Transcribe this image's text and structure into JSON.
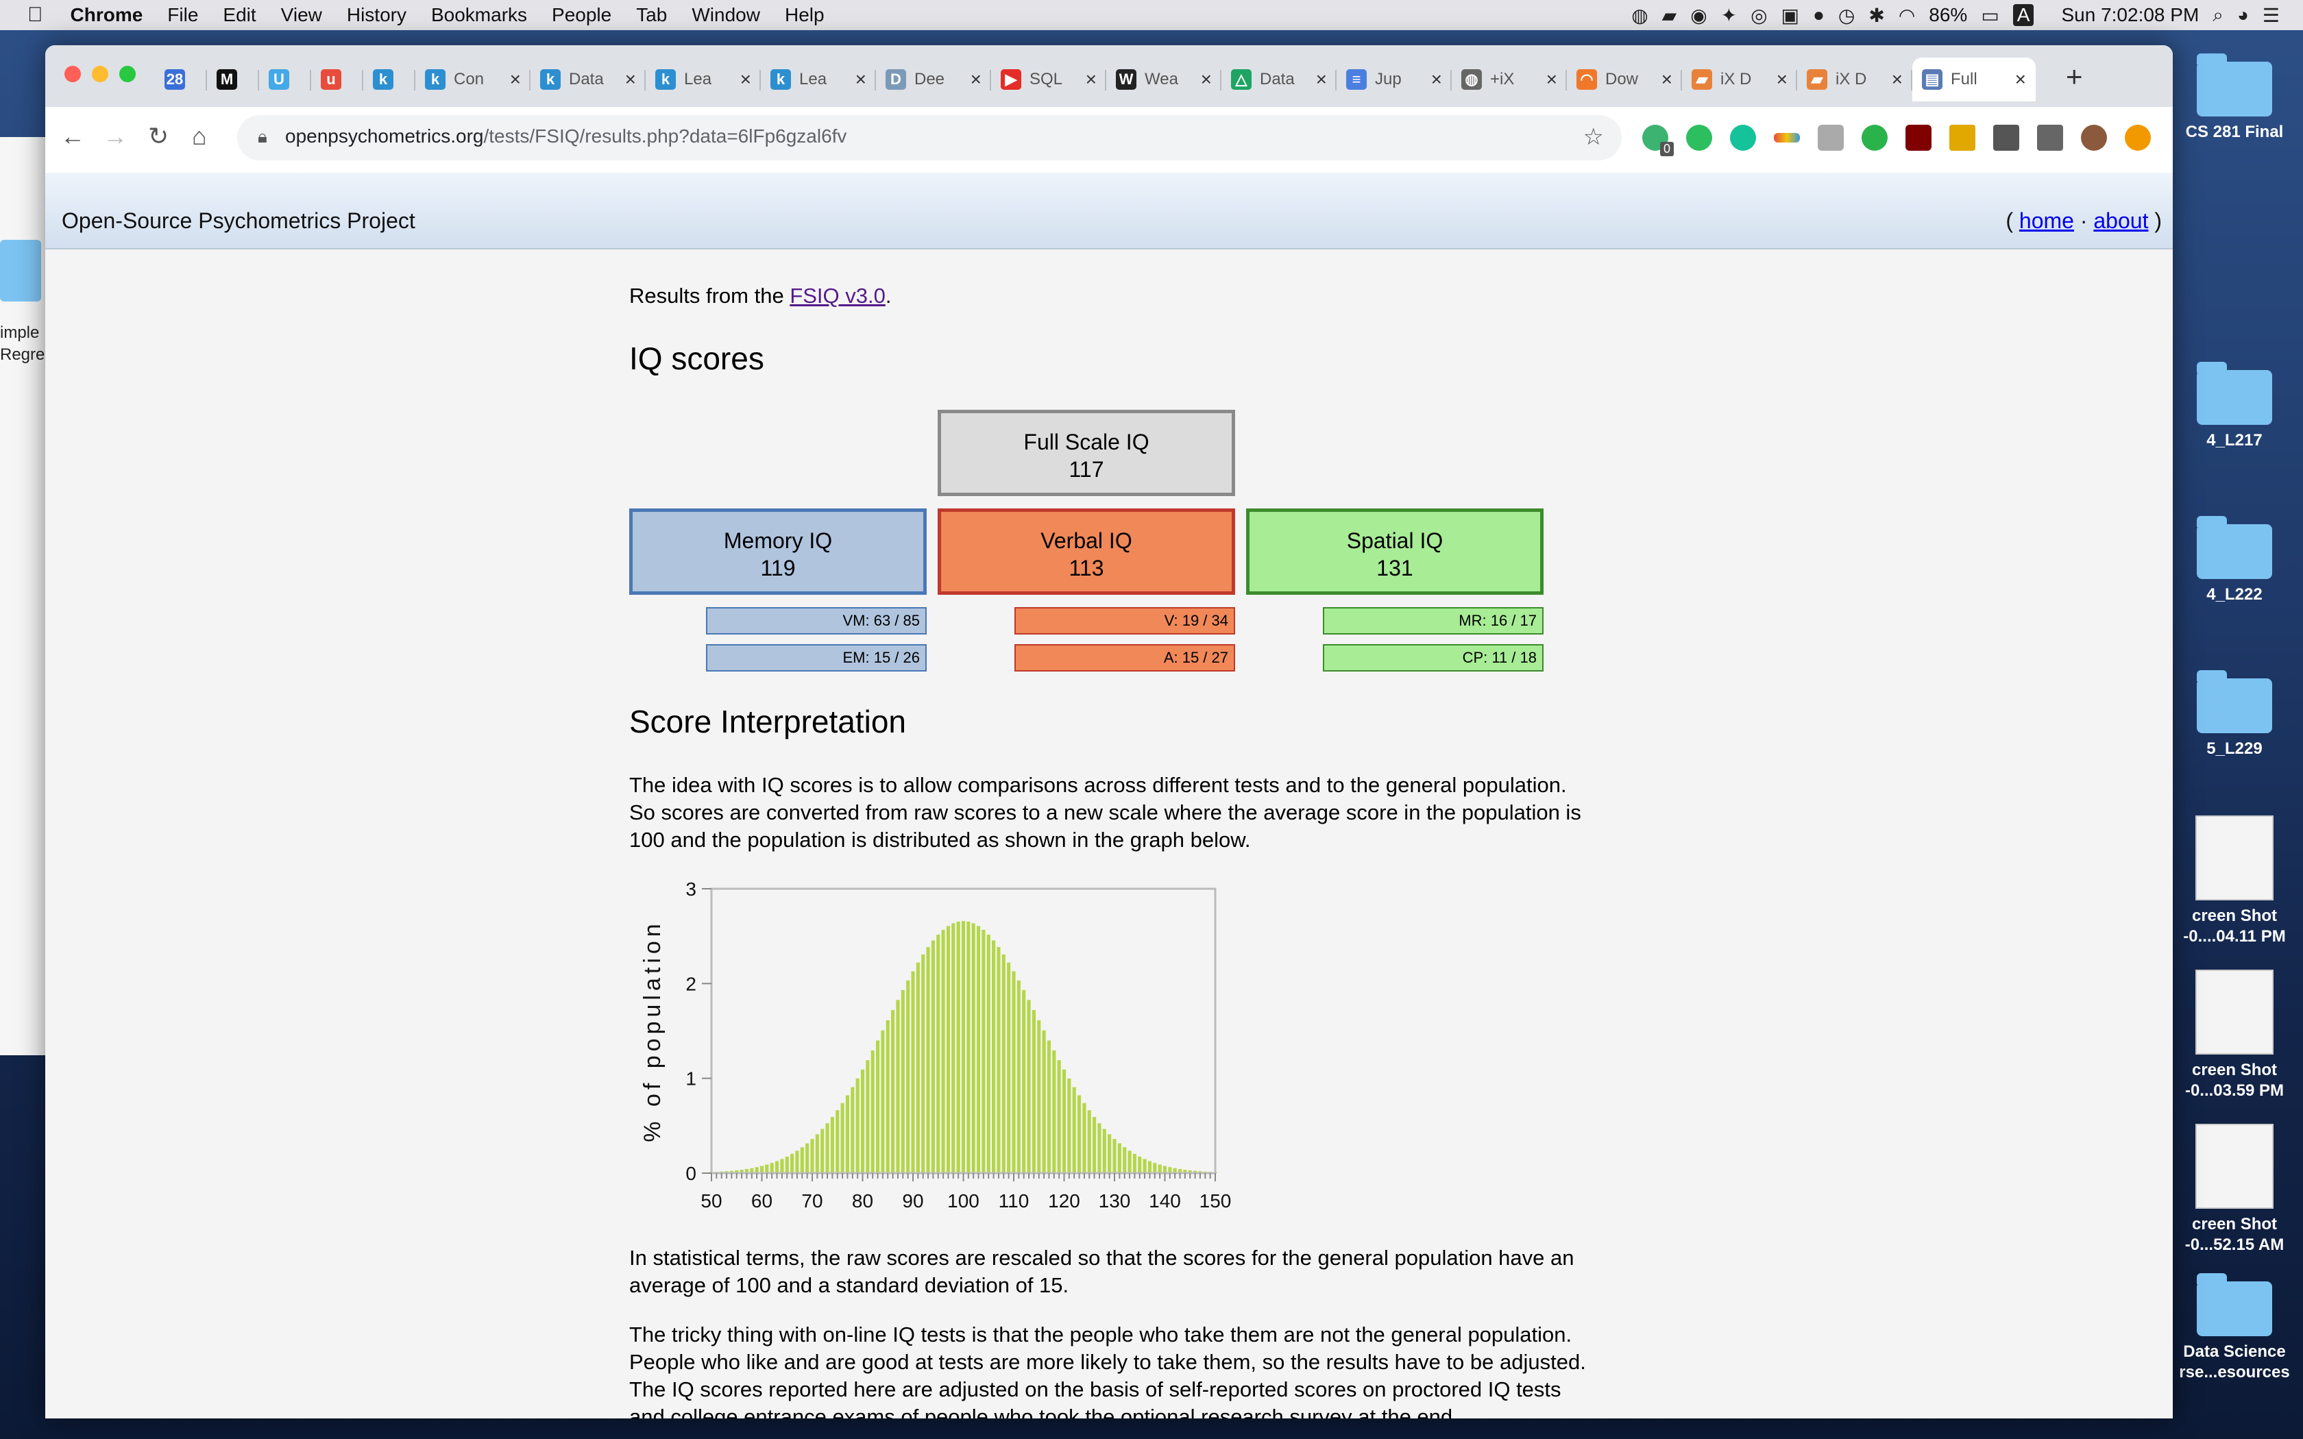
{
  "menubar": {
    "app": "Chrome",
    "items": [
      "File",
      "Edit",
      "View",
      "History",
      "Bookmarks",
      "People",
      "Tab",
      "Window",
      "Help"
    ],
    "battery": "86%",
    "input": "A",
    "clock": "Sun 7:02:08 PM"
  },
  "desktop": {
    "icons": [
      {
        "label": "CS 281 Final"
      },
      {
        "label": "4_L217"
      },
      {
        "label": "4_L222"
      },
      {
        "label": "5_L229"
      },
      {
        "label": "creen Shot\n-0....04.11 PM"
      },
      {
        "label": "creen Shot\n-0...03.59 PM"
      },
      {
        "label": "creen Shot\n-0...52.15 AM"
      },
      {
        "label": "Data Science\nrse...esources"
      }
    ],
    "left_label": "imple\nRegres"
  },
  "browser": {
    "tabs": [
      {
        "icon": "28",
        "title": "",
        "color": "#3b6fd8"
      },
      {
        "icon": "M",
        "title": "",
        "color": "#111111"
      },
      {
        "icon": "U",
        "title": "",
        "color": "#44a9e6"
      },
      {
        "icon": "u",
        "title": "",
        "color": "#e74c3c"
      },
      {
        "icon": "k",
        "title": "",
        "color": "#2d8fd0"
      },
      {
        "icon": "k",
        "title": "Con",
        "color": "#2d8fd0"
      },
      {
        "icon": "k",
        "title": "Data",
        "color": "#2d8fd0"
      },
      {
        "icon": "k",
        "title": "Lea",
        "color": "#2d8fd0"
      },
      {
        "icon": "k",
        "title": "Lea",
        "color": "#2d8fd0"
      },
      {
        "icon": "D",
        "title": "Dee",
        "color": "#7a9ab8"
      },
      {
        "icon": "▶",
        "title": "SQL",
        "color": "#e52d27"
      },
      {
        "icon": "W",
        "title": "Wea",
        "color": "#222222"
      },
      {
        "icon": "△",
        "title": "Data",
        "color": "#1fa463"
      },
      {
        "icon": "≡",
        "title": "Jup",
        "color": "#4a7fe0"
      },
      {
        "icon": "◍",
        "title": "+iX",
        "color": "#666666"
      },
      {
        "icon": "◠",
        "title": "Dow",
        "color": "#f0782a"
      },
      {
        "icon": "▰",
        "title": "iX D",
        "color": "#e8823a"
      },
      {
        "icon": "▰",
        "title": "iX D",
        "color": "#e8823a"
      },
      {
        "icon": "▤",
        "title": "Full",
        "color": "#5a7bb5"
      }
    ],
    "url_host": "openpsychometrics.org",
    "url_path": "/tests/FSIQ/results.php?data=6lFp6gzal6fv",
    "ext_badge": "0"
  },
  "site": {
    "title": "Open-Source Psychometrics Project",
    "open_paren": "( ",
    "home": "home",
    "sep": " · ",
    "about": "about",
    "close_paren": " )"
  },
  "content": {
    "intro_pre": "Results from the ",
    "intro_link": "FSIQ v3.0",
    "intro_post": ".",
    "heading_scores": "IQ scores",
    "full_scale": {
      "label": "Full Scale IQ",
      "value": "117"
    },
    "memory": {
      "label": "Memory IQ",
      "value": "119",
      "sub1": "VM: 63 / 85",
      "sub2": "EM: 15 / 26"
    },
    "verbal": {
      "label": "Verbal IQ",
      "value": "113",
      "sub1": "V: 19 / 34",
      "sub2": "A: 15 / 27"
    },
    "spatial": {
      "label": "Spatial IQ",
      "value": "131",
      "sub1": "MR: 16 / 17",
      "sub2": "CP: 11 / 18"
    },
    "heading_interp": "Score Interpretation",
    "para1": "The idea with IQ scores is to allow comparisons across different tests and to the general population. So scores are converted from raw scores to a new scale where the average score in the population is 100 and the population is distributed as shown in the graph below.",
    "para2": "In statistical terms, the raw scores are rescaled so that the scores for the general population have an average of 100 and a standard deviation of 15.",
    "para3": "The tricky thing with on-line IQ tests is that the people who take them are not the general population. People who like and are good at tests are more likely to take them, so the results have to be adjusted. The IQ scores reported here are adjusted on the basis of self-reported scores on proctored IQ tests and college entrance exams of people who took the optional research survey at the end."
  },
  "colors": {
    "memory_fill": "#b0c4de",
    "memory_border": "#4a78b5",
    "verbal_fill": "#f08858",
    "verbal_border": "#c0392b",
    "spatial_fill": "#a8ec96",
    "spatial_border": "#3c8c2c",
    "full_fill": "#dcdcdc",
    "full_border": "#8a8a8a",
    "bar": "#b4d64a"
  },
  "chart_data": {
    "type": "bar",
    "ylabel": "% of population",
    "xlim": [
      50,
      150
    ],
    "ylim": [
      0,
      3
    ],
    "xticks": [
      50,
      60,
      70,
      80,
      90,
      100,
      110,
      120,
      130,
      140,
      150
    ],
    "yticks": [
      0,
      1,
      2,
      3
    ],
    "distribution": {
      "mean": 100,
      "sd": 15
    },
    "x_start": 50,
    "x_end": 150,
    "x_step": 1
  }
}
